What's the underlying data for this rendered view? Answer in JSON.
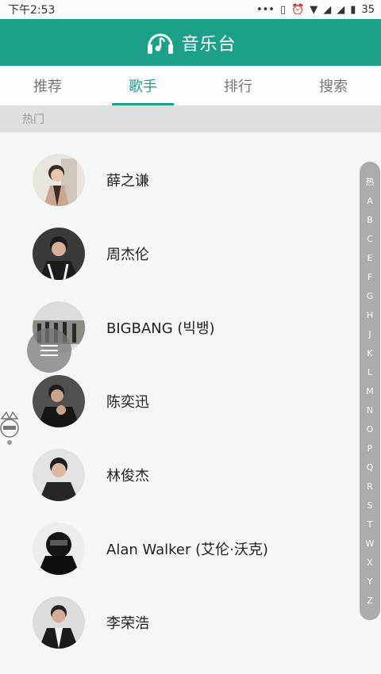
{
  "status_bar": {
    "time": "下午2:53",
    "battery": "35"
  },
  "header": {
    "title": "音乐台"
  },
  "tabs": [
    {
      "label": "推荐"
    },
    {
      "label": "歌手"
    },
    {
      "label": "排行"
    },
    {
      "label": "搜索"
    }
  ],
  "section": {
    "label": "热门"
  },
  "singers": [
    {
      "name": "薛之谦"
    },
    {
      "name": "周杰伦"
    },
    {
      "name": "BIGBANG (빅뱅)"
    },
    {
      "name": "陈奕迅"
    },
    {
      "name": "林俊杰"
    },
    {
      "name": "Alan Walker (艾伦·沃克)"
    },
    {
      "name": "李荣浩"
    }
  ],
  "index_letters": [
    "热",
    "A",
    "B",
    "C",
    "E",
    "F",
    "G",
    "H",
    "J",
    "K",
    "L",
    "M",
    "N",
    "O",
    "P",
    "Q",
    "R",
    "S",
    "T",
    "W",
    "X",
    "Y",
    "Z"
  ],
  "colors": {
    "accent": "#1da08a",
    "index_bg": "#a9adad"
  }
}
